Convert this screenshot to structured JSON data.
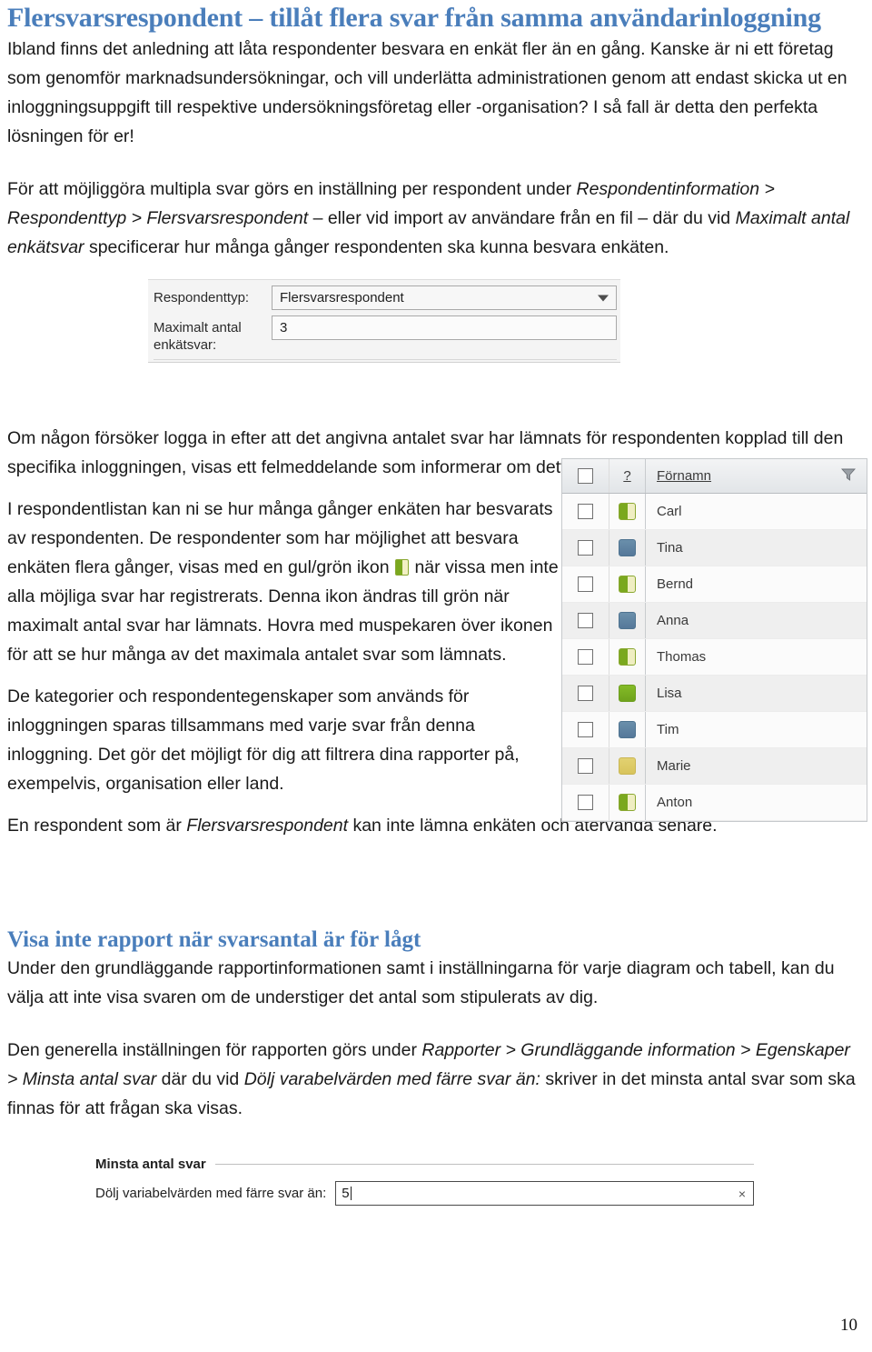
{
  "document": {
    "page_number": "10",
    "accent_color": "#4a7ebb"
  },
  "section1": {
    "heading": "Flersvarsrespondent – tillåt flera svar från samma användarinloggning",
    "intro_line1": "Ibland finns det anledning att låta respondenter besvara en enkät fler än en gång. Kanske är ni ett",
    "intro_line2": "företag som genomför marknadsundersökningar, och vill underlätta administrationen genom att",
    "intro_line3": "endast skicka ut en inloggningsuppgift till respektive undersökningsföretag eller -organisation? I så",
    "intro_line4": "fall är detta den perfekta lösningen för er!",
    "howto_part1": "För att möjliggöra multipla svar görs en inställning per respondent under ",
    "howto_em1": "Respondentinformation > Respondenttyp > Flersvarsrespondent",
    "howto_part2": " – eller vid import av användare från en fil – där du vid ",
    "howto_em2": "Maximalt antal enkätsvar",
    "howto_part3": " specificerar hur många gånger respondenten ska kunna besvara enkäten."
  },
  "respondent_type_form": {
    "label_type": "Respondenttyp:",
    "value_type": "Flersvarsrespondent",
    "label_max": "Maximalt antal enkätsvar:",
    "value_max": "3",
    "caret_icon": "chevron-down-icon"
  },
  "section2": {
    "para_error": "Om någon försöker logga in efter att det angivna antalet svar har lämnats för respondenten kopplad till den specifika inloggningen, visas ett felmeddelande som informerar om detta.",
    "para_list_a": "I respondentlistan kan ni se hur många gånger enkäten har besvarats av respondenten. De respondenter som har möjlighet att besvara enkäten flera gånger, visas med en gul/grön ikon ",
    "para_list_b": " när vissa men inte alla möjliga svar har registrerats. Denna ikon ändras till grön när maximalt antal svar har lämnats. Hovra med muspekaren över ikonen för att se hur många av det maximala antalet svar som lämnats.",
    "para_categories": "De kategorier och respondentegenskaper som används för inloggningen sparas tillsammans med varje svar från denna inloggning. Det gör det möjligt för dig att filtrera dina rapporter på, exempelvis, organisation eller land.",
    "para_final_a": "En respondent som är ",
    "para_final_em": "Flersvarsrespondent",
    "para_final_b": " kan inte lämna enkäten och återvända senare."
  },
  "respondent_list": {
    "header": {
      "select_all_checkbox": "select-all-checkbox",
      "status_column": "?",
      "name_column": "Förnamn",
      "filter_icon": "funnel-filter-icon"
    },
    "rows": [
      {
        "name": "Carl",
        "status": "split"
      },
      {
        "name": "Tina",
        "status": "blue"
      },
      {
        "name": "Bernd",
        "status": "split"
      },
      {
        "name": "Anna",
        "status": "blue"
      },
      {
        "name": "Thomas",
        "status": "split"
      },
      {
        "name": "Lisa",
        "status": "green"
      },
      {
        "name": "Tim",
        "status": "blue"
      },
      {
        "name": "Marie",
        "status": "yellow"
      },
      {
        "name": "Anton",
        "status": "split"
      }
    ]
  },
  "section3": {
    "heading": "Visa inte rapport när svarsantal är för lågt",
    "para_line1": "Under den grundläggande rapportinformationen samt i inställningarna för varje diagram och tabell,",
    "para_line2": "kan du välja att inte visa svaren om de understiger det antal som stipulerats av dig.",
    "para2_part1": "Den generella inställningen för rapporten görs under ",
    "para2_em1": "Rapporter > Grundläggande information > Egenskaper > Minsta antal svar",
    "para2_part2": " där du vid ",
    "para2_em2": "Dölj varabelvärden med färre svar än:",
    "para2_part3": " skriver in det minsta antal svar som ska finnas för att frågan ska visas."
  },
  "min_answers_form": {
    "legend": "Minsta antal svar",
    "field_label": "Dölj variabelvärden med färre svar än:",
    "field_value": "5",
    "clear_icon": "clear-x-icon"
  }
}
